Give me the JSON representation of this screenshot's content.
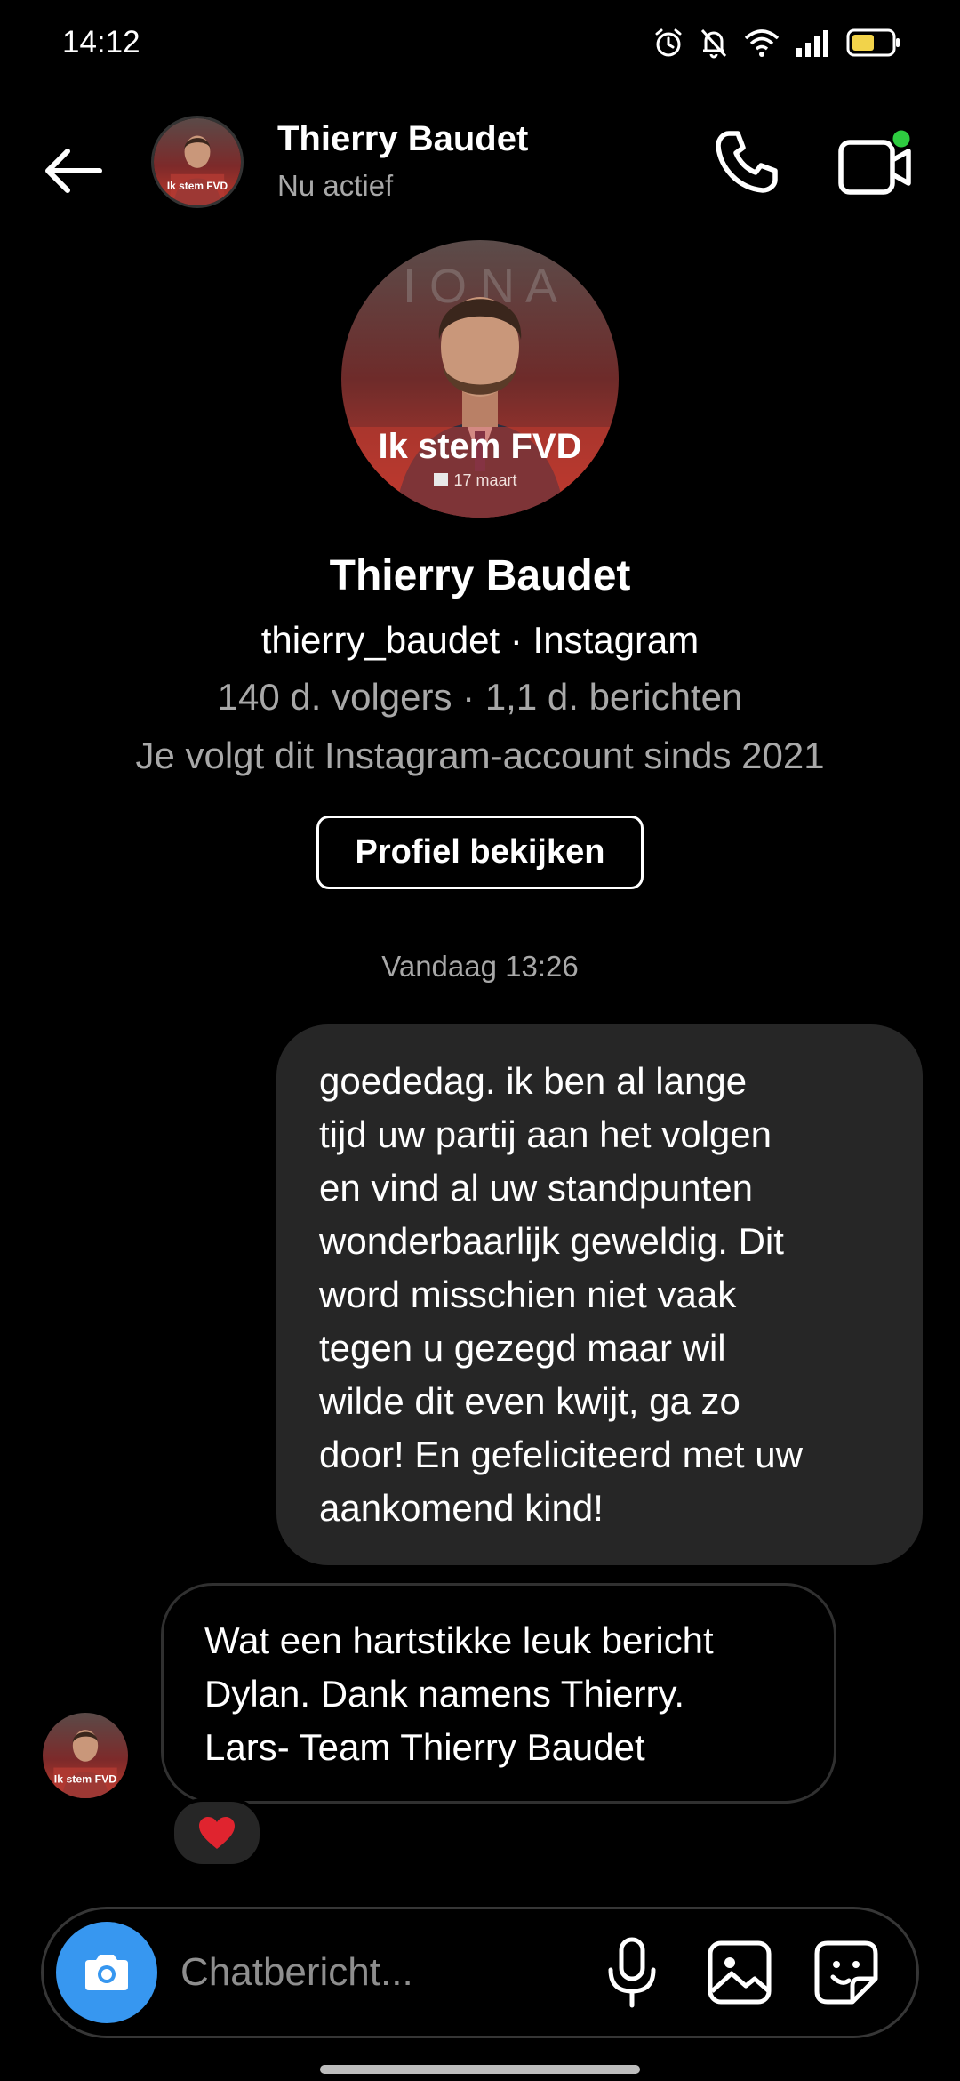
{
  "status_bar": {
    "time": "14:12",
    "icons": [
      "alarm-icon",
      "bell-muted-icon",
      "wifi-icon",
      "signal-icon",
      "battery-icon"
    ]
  },
  "header": {
    "name": "Thierry Baudet",
    "status": "Nu actief",
    "icons": [
      "back-arrow-icon",
      "phone-icon",
      "video-call-icon"
    ],
    "online_dot_color": "#2ecc40"
  },
  "avatar": {
    "caption": "Ik stem FVD",
    "date": "17 maart"
  },
  "profile": {
    "name": "Thierry Baudet",
    "handle": "thierry_baudet · Instagram",
    "stats": "140 d. volgers · 1,1 d. berichten",
    "since": "Je volgt dit Instagram-account sinds 2021",
    "button_label": "Profiel bekijken"
  },
  "conversation": {
    "timestamp": "Vandaag 13:26",
    "messages": [
      {
        "direction": "outgoing",
        "lines": [
          "goededag. ik ben al lange",
          "tijd uw partij aan het volgen",
          "en vind al uw standpunten",
          "wonderbaarlijk geweldig. Dit",
          "word misschien niet vaak",
          "tegen u gezegd maar wil",
          "wilde dit even kwijt, ga zo",
          "door! En gefeliciteerd met uw",
          "aankomend kind!"
        ]
      },
      {
        "direction": "incoming",
        "lines": [
          "Wat een hartstikke leuk bericht",
          "Dylan. Dank namens Thierry.",
          "Lars- Team Thierry Baudet"
        ],
        "reaction": "heart-icon"
      }
    ]
  },
  "composer": {
    "placeholder": "Chatbericht...",
    "icons": [
      "camera-icon",
      "microphone-icon",
      "gallery-icon",
      "sticker-icon"
    ],
    "accent_color": "#3797f0"
  },
  "colors": {
    "background": "#000000",
    "bubble": "#262626",
    "secondary_text": "#a8a8a8"
  }
}
